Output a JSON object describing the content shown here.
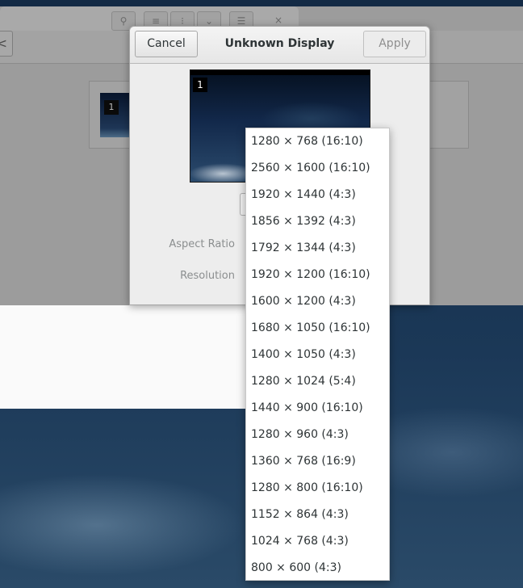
{
  "dialog": {
    "title": "Unknown Display",
    "cancel_label": "Cancel",
    "apply_label": "Apply",
    "monitor_number": "1",
    "aspect_ratio_label": "Aspect Ratio",
    "resolution_label": "Resolution"
  },
  "background_window": {
    "monitor_number": "1",
    "back_glyph": "<",
    "toolbar_glyphs": [
      "⚲",
      "≡",
      "⁝",
      "⌄",
      "☰",
      "×"
    ]
  },
  "resolution_menu": {
    "items": [
      "1280 × 768 (16:10)",
      "2560 × 1600 (16:10)",
      "1920 × 1440 (4:3)",
      "1856 × 1392 (4:3)",
      "1792 × 1344 (4:3)",
      "1920 × 1200 (16:10)",
      "1600 × 1200 (4:3)",
      "1680 × 1050 (16:10)",
      "1400 × 1050 (4:3)",
      "1280 × 1024 (5:4)",
      "1440 × 900 (16:10)",
      "1280 × 960 (4:3)",
      "1360 × 768 (16:9)",
      "1280 × 800 (16:10)",
      "1152 × 864 (4:3)",
      "1024 × 768 (4:3)",
      "800 × 600 (4:3)"
    ]
  },
  "colors": {
    "desktop": "#1d3650",
    "dialog_bg": "#ededed",
    "text": "#2e3436",
    "dim_label": "#8b8e8f"
  }
}
